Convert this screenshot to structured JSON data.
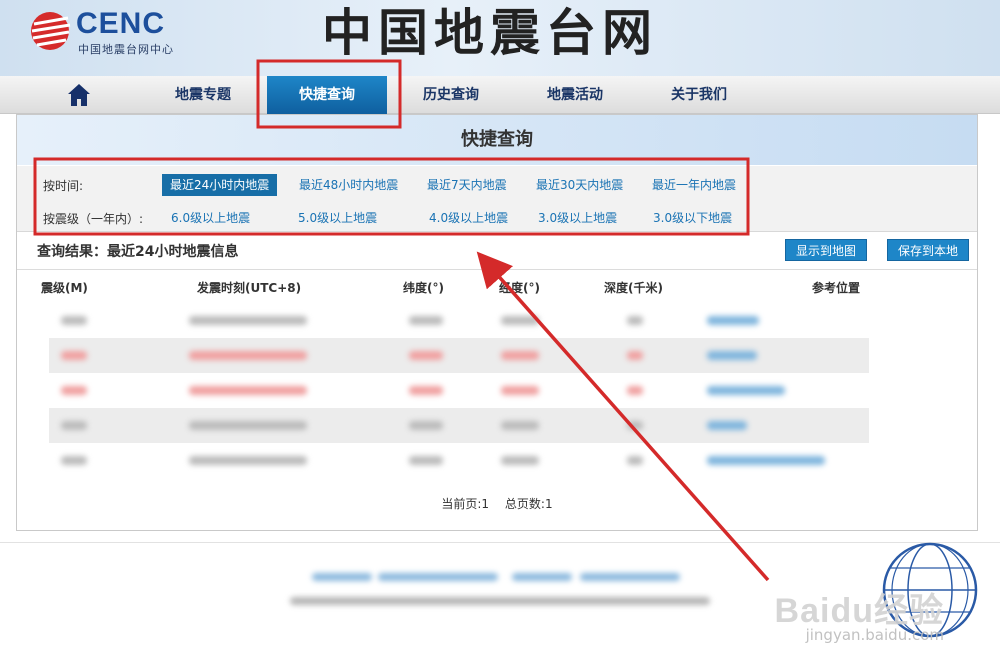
{
  "header": {
    "logo_text": "CENC",
    "logo_sub": "中国地震台网中心",
    "site_title": "中国地震台网"
  },
  "nav": {
    "items": [
      {
        "label": "地震专题"
      },
      {
        "label": "快捷查询",
        "active": true
      },
      {
        "label": "历史查询"
      },
      {
        "label": "地震活动"
      },
      {
        "label": "关于我们"
      }
    ]
  },
  "panel": {
    "title": "快捷查询",
    "time_filter": {
      "label": "按时间:",
      "options": [
        "最近24小时内地震",
        "最近48小时内地震",
        "最近7天内地震",
        "最近30天内地震",
        "最近一年内地震"
      ],
      "selected": "最近24小时内地震"
    },
    "mag_filter": {
      "label": "按震级（一年内）:",
      "options": [
        "6.0级以上地震",
        "5.0级以上地震",
        "4.0级以上地震",
        "3.0级以上地震",
        "3.0级以下地震"
      ]
    },
    "result_title": "查询结果：最近24小时地震信息",
    "buttons": {
      "show_map": "显示到地图",
      "save_local": "保存到本地"
    },
    "table_headers": [
      "震级(M)",
      "发震时刻(UTC+8)",
      "纬度(°)",
      "经度(°)",
      "深度(千米)",
      "参考位置"
    ],
    "row_count": 5,
    "pager": {
      "current": "当前页:1",
      "total": "总页数:1"
    }
  },
  "watermark": {
    "brand": "Baidu经验",
    "url": "jingyan.baidu.com"
  },
  "colors": {
    "accent": "#1e86c8",
    "annotation": "#d42a2a",
    "link": "#1a73b4"
  }
}
